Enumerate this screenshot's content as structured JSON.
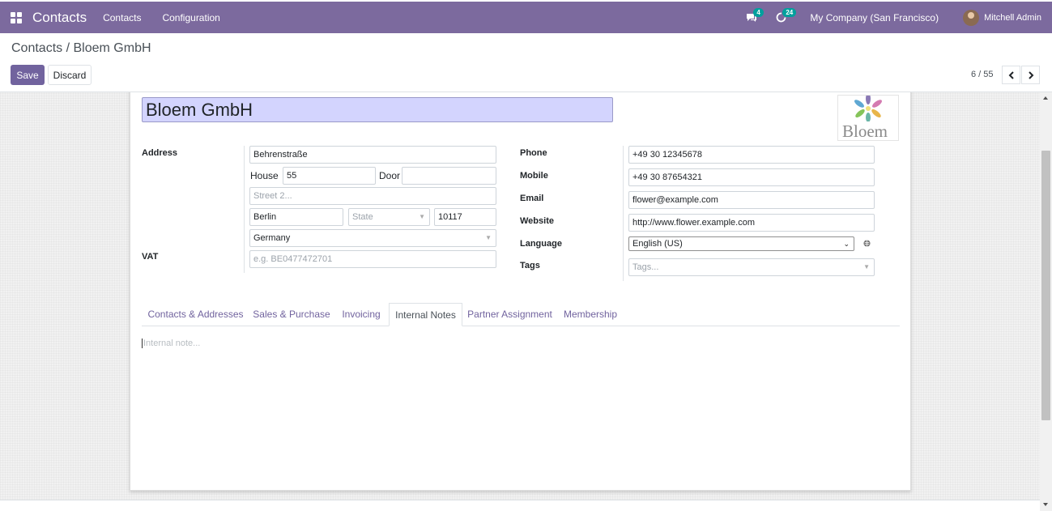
{
  "navbar": {
    "app_name": "Contacts",
    "menu": [
      "Contacts",
      "Configuration"
    ],
    "messages_count": "4",
    "activities_count": "24",
    "company": "My Company (San Francisco)",
    "user": "Mitchell Admin",
    "color": "#7c6a9e"
  },
  "breadcrumb": {
    "parent": "Contacts",
    "separator": "/",
    "current": "Bloem GmbH"
  },
  "buttons": {
    "save": "Save",
    "discard": "Discard"
  },
  "pager": {
    "value": "6 / 55"
  },
  "form": {
    "name": "Bloem GmbH",
    "logo_text": "Bloem",
    "address_label": "Address",
    "street": "Behrenstraße",
    "house_label": "House",
    "house": "55",
    "door_label": "Door",
    "door": "",
    "street2_placeholder": "Street 2...",
    "city": "Berlin",
    "state_placeholder": "State",
    "zip": "10117",
    "country": "Germany",
    "vat_label": "VAT",
    "vat_placeholder": "e.g. BE0477472701",
    "phone_label": "Phone",
    "phone": "+49 30 12345678",
    "mobile_label": "Mobile",
    "mobile": "+49 30 87654321",
    "email_label": "Email",
    "email": "flower@example.com",
    "website_label": "Website",
    "website": "http://www.flower.example.com",
    "language_label": "Language",
    "language": "English (US)",
    "tags_label": "Tags",
    "tags_placeholder": "Tags..."
  },
  "tabs": [
    {
      "label": "Contacts & Addresses"
    },
    {
      "label": "Sales & Purchase"
    },
    {
      "label": "Invoicing"
    },
    {
      "label": "Internal Notes",
      "active": true
    },
    {
      "label": "Partner Assignment"
    },
    {
      "label": "Membership"
    }
  ],
  "notes": {
    "placeholder": "Internal note..."
  },
  "colors": {
    "primary": "#71639e",
    "name_field_bg": "#d3d4fe",
    "badge": "#00a09d"
  }
}
